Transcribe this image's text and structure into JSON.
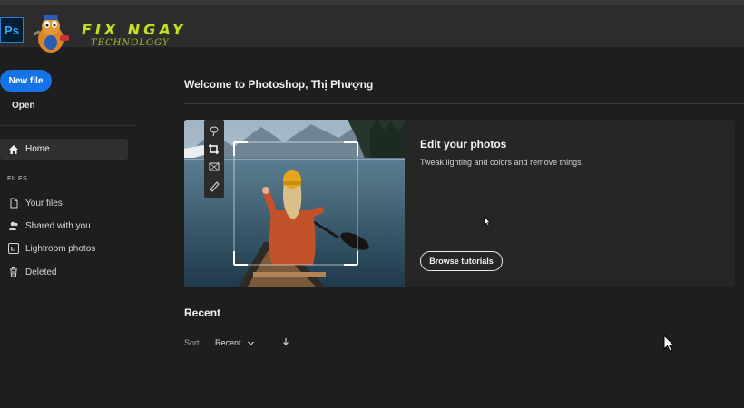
{
  "app": {
    "logo_text": "Ps",
    "brand_name": "FIX NGAY",
    "brand_sub": "TECHNOLOGY"
  },
  "sidebar": {
    "new_file": "New file",
    "open": "Open",
    "home": "Home",
    "section": "FILES",
    "items": [
      {
        "label": "Your files",
        "icon": "file-icon"
      },
      {
        "label": "Shared with you",
        "icon": "people-icon"
      },
      {
        "label": "Lightroom photos",
        "icon": "lightroom-icon",
        "icon_text": "Lr"
      },
      {
        "label": "Deleted",
        "icon": "trash-icon"
      }
    ]
  },
  "main": {
    "welcome": "Welcome to Photoshop, Thị Phượng",
    "hero": {
      "title": "Edit your photos",
      "description": "Tweak lighting and colors and remove things.",
      "button": "Browse tutorials"
    },
    "recent": {
      "title": "Recent",
      "sort_label": "Sort",
      "sort_value": "Recent"
    }
  },
  "colors": {
    "accent": "#1473e6",
    "background": "#1e1e1e",
    "card": "#262626"
  }
}
